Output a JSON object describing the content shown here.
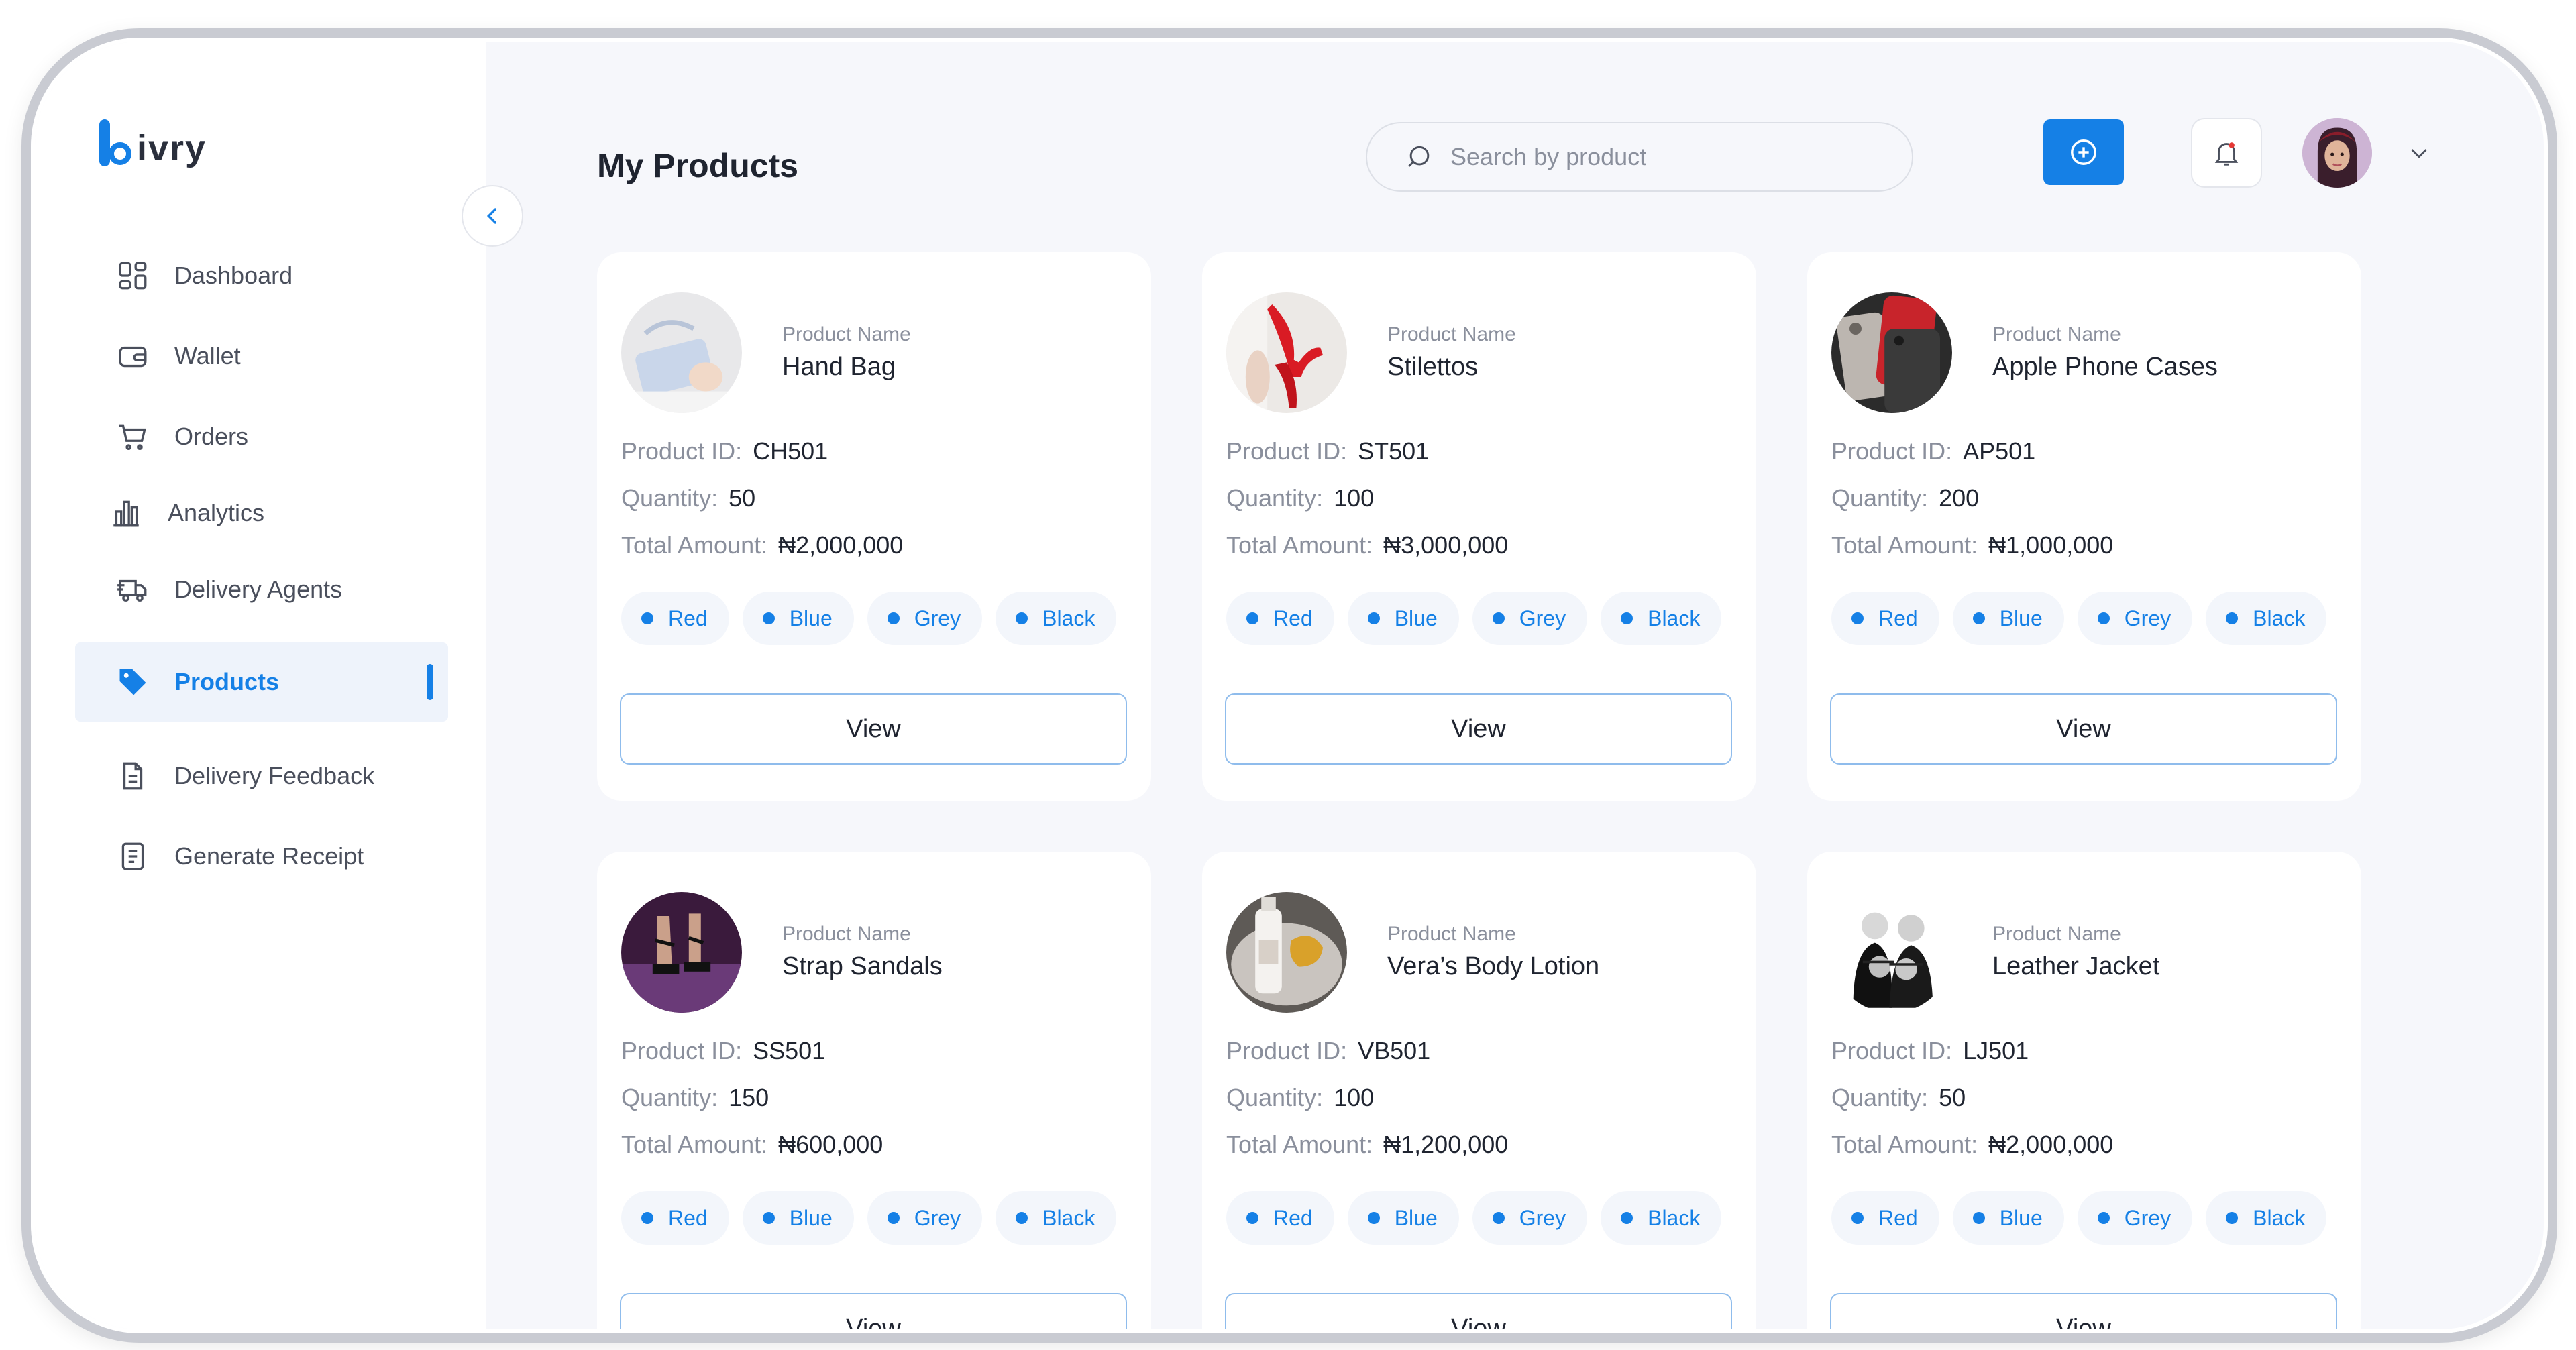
{
  "brand": {
    "name": "ivry"
  },
  "sidebar": {
    "items": [
      {
        "label": "Dashboard",
        "icon": "grid-icon"
      },
      {
        "label": "Wallet",
        "icon": "wallet-icon"
      },
      {
        "label": "Orders",
        "icon": "cart-icon"
      },
      {
        "label": "Analytics",
        "icon": "bar-chart-icon"
      },
      {
        "label": "Delivery Agents",
        "icon": "delivery-truck-icon"
      },
      {
        "label": "Products",
        "icon": "tag-icon",
        "active": true
      },
      {
        "label": "Delivery Feedback",
        "icon": "document-icon"
      },
      {
        "label": "Generate Receipt",
        "icon": "receipt-icon"
      }
    ]
  },
  "header": {
    "title": "My Products",
    "search_placeholder": "Search by product"
  },
  "labels": {
    "product_name": "Product Name",
    "product_id": "Product ID:",
    "quantity": "Quantity:",
    "total_amount": "Total Amount:",
    "view": "View"
  },
  "colors": {
    "accent": "#1580e6",
    "chip_bg": "#f3f6fb",
    "page_bg": "#f6f7fb"
  },
  "products": [
    {
      "name": "Hand Bag",
      "id": "CH501",
      "quantity": "50",
      "total": "₦2,000,000",
      "colors": [
        "Red",
        "Blue",
        "Grey",
        "Black"
      ]
    },
    {
      "name": "Stilettos",
      "id": "ST501",
      "quantity": "100",
      "total": "₦3,000,000",
      "colors": [
        "Red",
        "Blue",
        "Grey",
        "Black"
      ]
    },
    {
      "name": "Apple Phone Cases",
      "id": "AP501",
      "quantity": "200",
      "total": "₦1,000,000",
      "colors": [
        "Red",
        "Blue",
        "Grey",
        "Black"
      ]
    },
    {
      "name": "Strap Sandals",
      "id": "SS501",
      "quantity": "150",
      "total": "₦600,000",
      "colors": [
        "Red",
        "Blue",
        "Grey",
        "Black"
      ]
    },
    {
      "name": "Vera’s Body Lotion",
      "id": "VB501",
      "quantity": "100",
      "total": "₦1,200,000",
      "colors": [
        "Red",
        "Blue",
        "Grey",
        "Black"
      ]
    },
    {
      "name": "Leather Jacket",
      "id": "LJ501",
      "quantity": "50",
      "total": "₦2,000,000",
      "colors": [
        "Red",
        "Blue",
        "Grey",
        "Black"
      ]
    }
  ]
}
